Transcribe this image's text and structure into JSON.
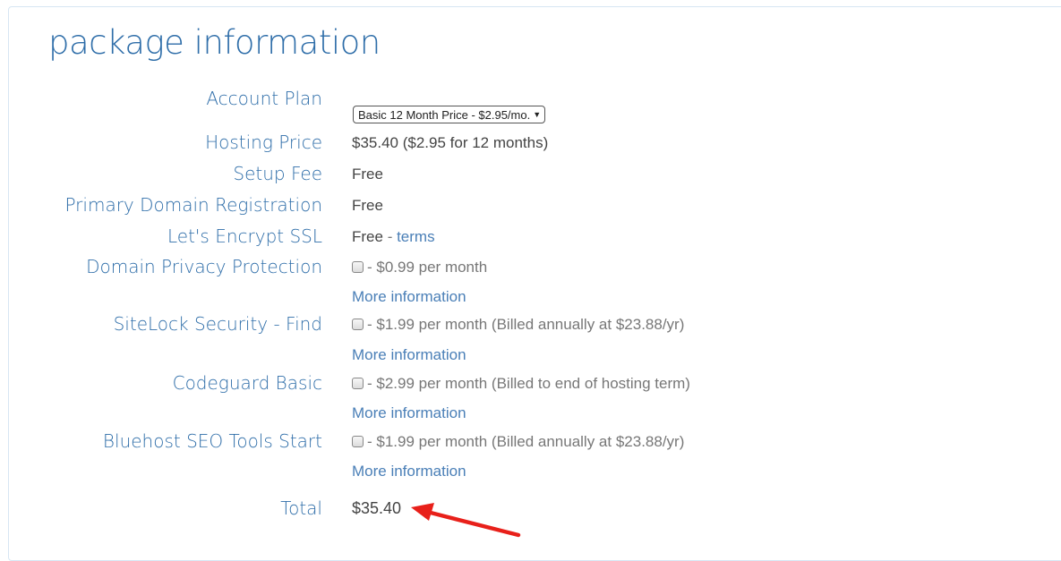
{
  "title": "package information",
  "account_plan": {
    "label": "Account Plan",
    "selected": "Basic 12 Month Price - $2.95/mo."
  },
  "hosting_price": {
    "label": "Hosting Price",
    "value": "$35.40 ($2.95 for 12 months)"
  },
  "setup_fee": {
    "label": "Setup Fee",
    "value": "Free"
  },
  "primary_domain": {
    "label": "Primary Domain Registration",
    "value": "Free"
  },
  "ssl": {
    "label": "Let's Encrypt SSL",
    "value": "Free",
    "sep": " - ",
    "link": "terms"
  },
  "addons": [
    {
      "label": "Domain Privacy Protection",
      "price": "- $0.99 per month",
      "more": "More information"
    },
    {
      "label": "SiteLock Security - Find",
      "price": "- $1.99 per month (Billed annually at $23.88/yr)",
      "more": "More information"
    },
    {
      "label": "Codeguard Basic",
      "price": "- $2.99 per month (Billed to end of hosting term)",
      "more": "More information"
    },
    {
      "label": "Bluehost SEO Tools Start",
      "price": "- $1.99 per month (Billed annually at $23.88/yr)",
      "more": "More information"
    }
  ],
  "total": {
    "label": "Total",
    "value": "$35.40"
  },
  "colors": {
    "label": "#2f6ea9",
    "link": "#4a7fb7",
    "arrow": "#e8201a"
  }
}
